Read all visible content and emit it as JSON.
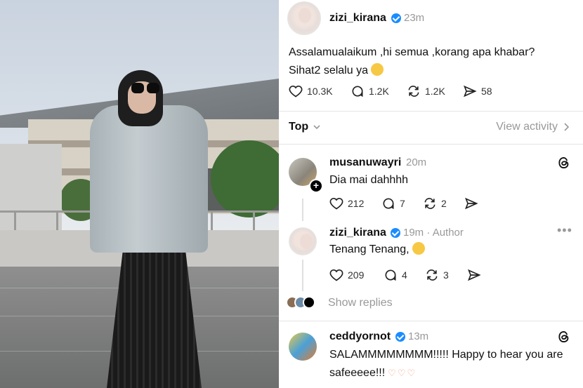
{
  "post": {
    "username": "zizi_kirana",
    "time": "23m",
    "text_line1": "Assalamualaikum ,hi semua ,korang apa khabar?",
    "text_line2": "Sihat2 selalu ya",
    "likes": "10.3K",
    "replies": "1.2K",
    "reposts": "1.2K",
    "shares": "58"
  },
  "sort": {
    "label": "Top",
    "activity_link": "View activity"
  },
  "replies": [
    {
      "username": "musanuwayri",
      "time": "20m",
      "text": "Dia mai dahhhh",
      "likes": "212",
      "replies": "7",
      "reposts": "2"
    },
    {
      "username": "zizi_kirana",
      "time": "19m",
      "author_tag": "· Author",
      "text": "Tenang Tenang,",
      "likes": "209",
      "replies": "4",
      "reposts": "3",
      "show_replies": "Show replies"
    },
    {
      "username": "ceddyornot",
      "time": "13m",
      "text_line1": "SALAMMMMMMMM!!!!! Happy to hear you are",
      "text_line2": "safeeeee!!!"
    }
  ],
  "colors": {
    "verified": "#1a8cff",
    "muted": "#999999",
    "text": "#101010"
  },
  "icons": [
    "heart-icon",
    "comment-icon",
    "repost-icon",
    "share-icon",
    "chevron-down-icon",
    "chevron-right-icon",
    "threads-icon",
    "more-icon",
    "verified-icon",
    "follow-plus-icon"
  ]
}
